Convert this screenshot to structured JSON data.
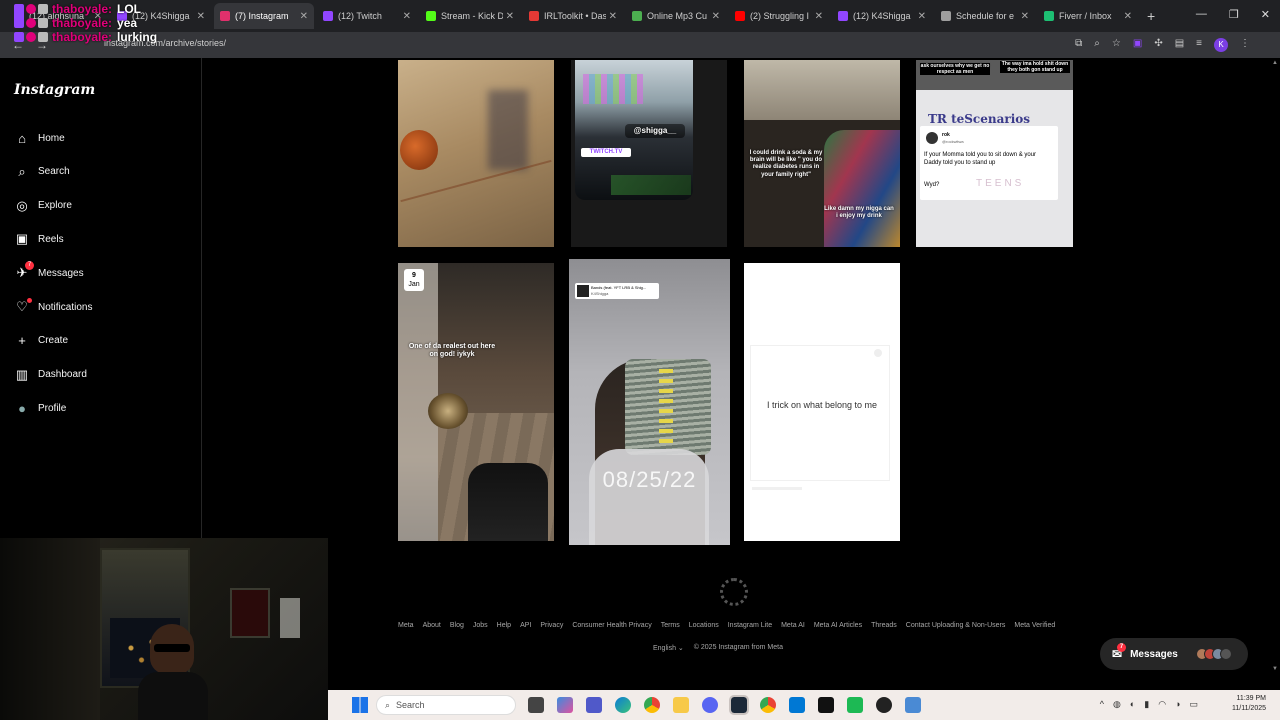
{
  "browser": {
    "tabs": [
      {
        "label": "(12) alghsuna",
        "color": "#9146ff"
      },
      {
        "label": "(12) K4Shigga",
        "color": "#9146ff"
      },
      {
        "label": "(7) Instagram",
        "color": "#e1306c",
        "active": true
      },
      {
        "label": "(12) Twitch",
        "color": "#9146ff"
      },
      {
        "label": "Stream - Kick D",
        "color": "#53fc18"
      },
      {
        "label": "IRLToolkit • Das",
        "color": "#e53935"
      },
      {
        "label": "Online Mp3 Cu",
        "color": "#4caf50"
      },
      {
        "label": "(2) Struggling I",
        "color": "#ff0000"
      },
      {
        "label": "(12) K4Shigga",
        "color": "#9146ff"
      },
      {
        "label": "Schedule for e",
        "color": "#9e9e9e"
      },
      {
        "label": "Fiverr / Inbox",
        "color": "#1dbf73"
      }
    ],
    "url": "instagram.com/archive/stories/"
  },
  "chat": [
    {
      "user": "thaboyale:",
      "message": "LOL"
    },
    {
      "user": "thaboyale:",
      "message": "yea"
    },
    {
      "user": "thaboyale:",
      "message": "lurking"
    }
  ],
  "sidebar": {
    "logo": "Instagram",
    "items": [
      {
        "label": "Home",
        "icon": "home-icon"
      },
      {
        "label": "Search",
        "icon": "search-icon"
      },
      {
        "label": "Explore",
        "icon": "compass-icon"
      },
      {
        "label": "Reels",
        "icon": "reels-icon"
      },
      {
        "label": "Messages",
        "icon": "messenger-icon",
        "badge": "7"
      },
      {
        "label": "Notifications",
        "icon": "heart-icon"
      },
      {
        "label": "Create",
        "icon": "plus-icon"
      },
      {
        "label": "Dashboard",
        "icon": "dashboard-icon"
      },
      {
        "label": "Profile",
        "icon": "avatar-icon"
      }
    ]
  },
  "stories": {
    "row1": [
      {
        "caption": ""
      },
      {
        "caption": "@shigga__",
        "sub": "TWITCH.TV"
      },
      {
        "caption": "I could drink a soda & my brain will be like \" you do realize diabetes runs in your family right\"",
        "caption2": "Like damn my nigga can i enjoy my drink"
      },
      {
        "caption": "ask ourselves why we get no respect as men",
        "caption2": "The way ima hold shit down they both gon stand up",
        "tweet_user": "rok",
        "tweet_handle": "@rockwitwa",
        "tweet_text": "If your Momma told you to sit down & your Daddy told you to stand up",
        "tweet_reply": "Wyd?",
        "brand": "TR teScenarios",
        "brand2": "TEENS"
      }
    ],
    "row2": [
      {
        "date_day": "9",
        "date_month": "Jan",
        "caption": "One of da realest out here on god! iykyk"
      },
      {
        "big_date": "08/25/22",
        "card_title": "Bands (feat. YFT LRB & Shig...",
        "card_sub": "K4Shigga"
      },
      {
        "caption": "I trick on what belong to me"
      }
    ]
  },
  "footer": {
    "links": [
      "Meta",
      "About",
      "Blog",
      "Jobs",
      "Help",
      "API",
      "Privacy",
      "Consumer Health Privacy",
      "Terms",
      "Locations",
      "Instagram Lite",
      "Meta AI",
      "Meta AI Articles",
      "Threads",
      "Contact Uploading & Non-Users",
      "Meta Verified"
    ],
    "language": "English",
    "copyright": "© 2025 Instagram from Meta"
  },
  "messages_pill": {
    "label": "Messages",
    "badge": "7"
  },
  "taskbar": {
    "search_placeholder": "Search",
    "time": "11:39 PM",
    "date": "11/11/2025"
  }
}
